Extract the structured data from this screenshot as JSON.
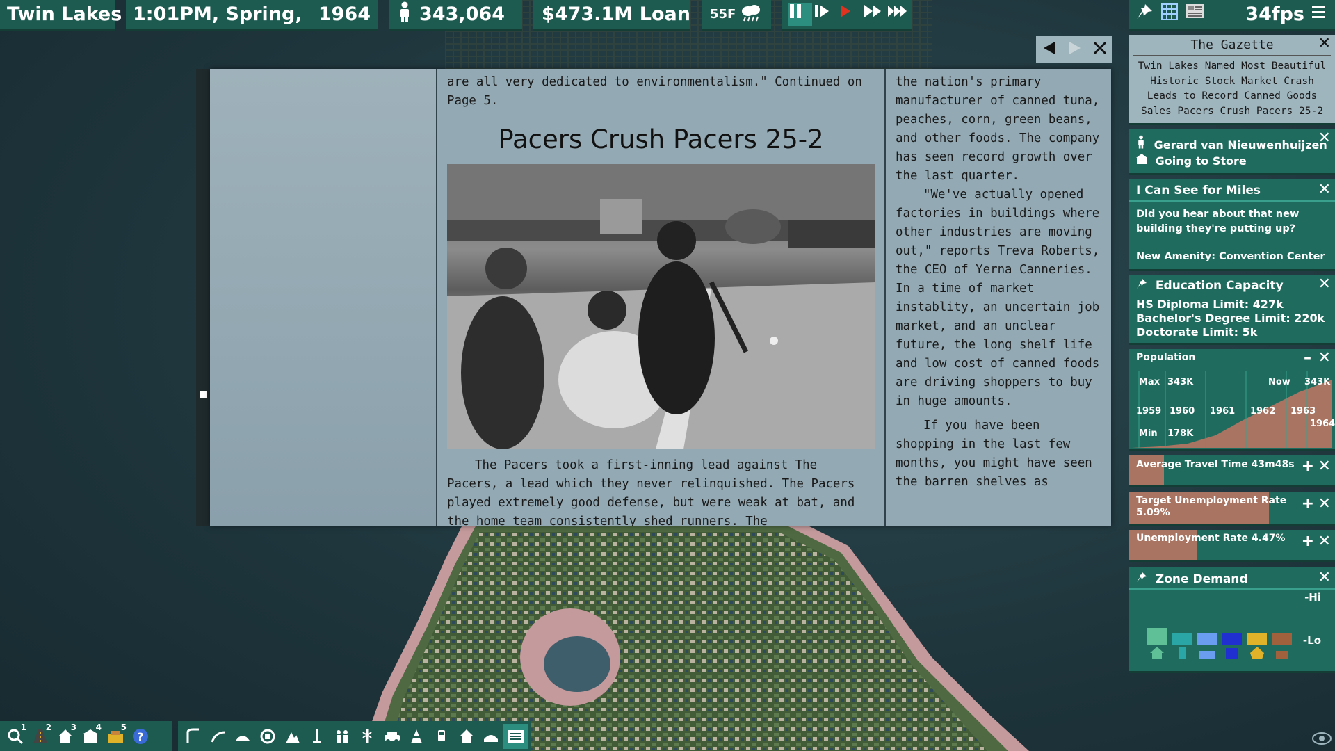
{
  "topbar": {
    "city": "Twin Lakes",
    "datetime": "1:01PM, Spring,",
    "year": "1964",
    "population": "343,064",
    "money": "$473.1M",
    "loan": "Loan",
    "temperature": "55F",
    "fps": "34fps"
  },
  "newspaper": {
    "intro_text": "are all very dedicated to environmentalism.\" Continued on Page 5.",
    "headline": "Pacers Crush Pacers 25-2",
    "body_text": "The Pacers took a first-inning lead against The Pacers, a lead which they never relinquished. The Pacers played extremely good defense, but were weak at bat, and the home team consistently shed runners. The",
    "right_para1": "the nation's primary manufacturer of canned tuna, peaches, corn, green beans, and other foods. The company has seen record growth over the last quarter.",
    "right_para2": "\"We've actually opened factories in buildings where other industries are moving out,\" reports Treva Roberts, the CEO of Yerna Canneries. In a time of market instablity, an uncertain job market, and an unclear future, the long shelf life and low cost of canned foods are driving shoppers to buy in huge amounts.",
    "right_para3": "If you have been shopping in the last few months, you might have seen the barren shelves as"
  },
  "gazette": {
    "title": "The Gazette",
    "headlines": "Twin Lakes Named Most Beautiful Historic Stock Market Crash Leads to Record Canned Goods Sales Pacers Crush Pacers 25-2"
  },
  "citizen": {
    "name": "Gerard van Nieuwenhuijzen",
    "status": "Going to Store"
  },
  "chat": {
    "title": "I Can See for Miles",
    "message": "Did you hear about that new building they're putting up?",
    "amenity": "New Amenity: Convention Center"
  },
  "education": {
    "title": "Education Capacity",
    "hs": "HS Diploma Limit: 427k",
    "bachelor": "Bachelor's Degree Limit: 220k",
    "doctorate": "Doctorate Limit: 5k"
  },
  "population_chart": {
    "title": "Population",
    "max_label": "Max",
    "max_value": "343K",
    "now_label": "Now",
    "now_value": "343K",
    "min_label": "Min",
    "min_value": "178K",
    "years": [
      "1959",
      "1960",
      "1961",
      "1962",
      "1963",
      "1964"
    ]
  },
  "metrics": {
    "travel": {
      "label": "Average Travel Time 43m48s",
      "fill": 0.17
    },
    "target_unemp": {
      "label": "Target Unemployment Rate",
      "value": "5.09%",
      "fill": 0.68
    },
    "unemp": {
      "label": "Unemployment Rate 4.47%",
      "fill": 0.33
    }
  },
  "zone_demand": {
    "title": "Zone Demand",
    "hi": "-Hi",
    "lo": "-Lo",
    "bars": [
      {
        "name": "residential",
        "color": "#5fbf96",
        "level": 0.55
      },
      {
        "name": "office",
        "color": "#2aa6a6",
        "level": 0.4
      },
      {
        "name": "retail",
        "color": "#6a9cf0",
        "level": 0.4
      },
      {
        "name": "farm",
        "color": "#1f2fd0",
        "level": 0.4
      },
      {
        "name": "commercial",
        "color": "#e0b22a",
        "level": 0.4
      },
      {
        "name": "industrial",
        "color": "#a0613c",
        "level": 0.4
      }
    ]
  },
  "toolbar": {
    "query_num": "1",
    "roads_num": "2",
    "zones_num": "3",
    "buildings_num": "4",
    "budget_num": "5"
  }
}
